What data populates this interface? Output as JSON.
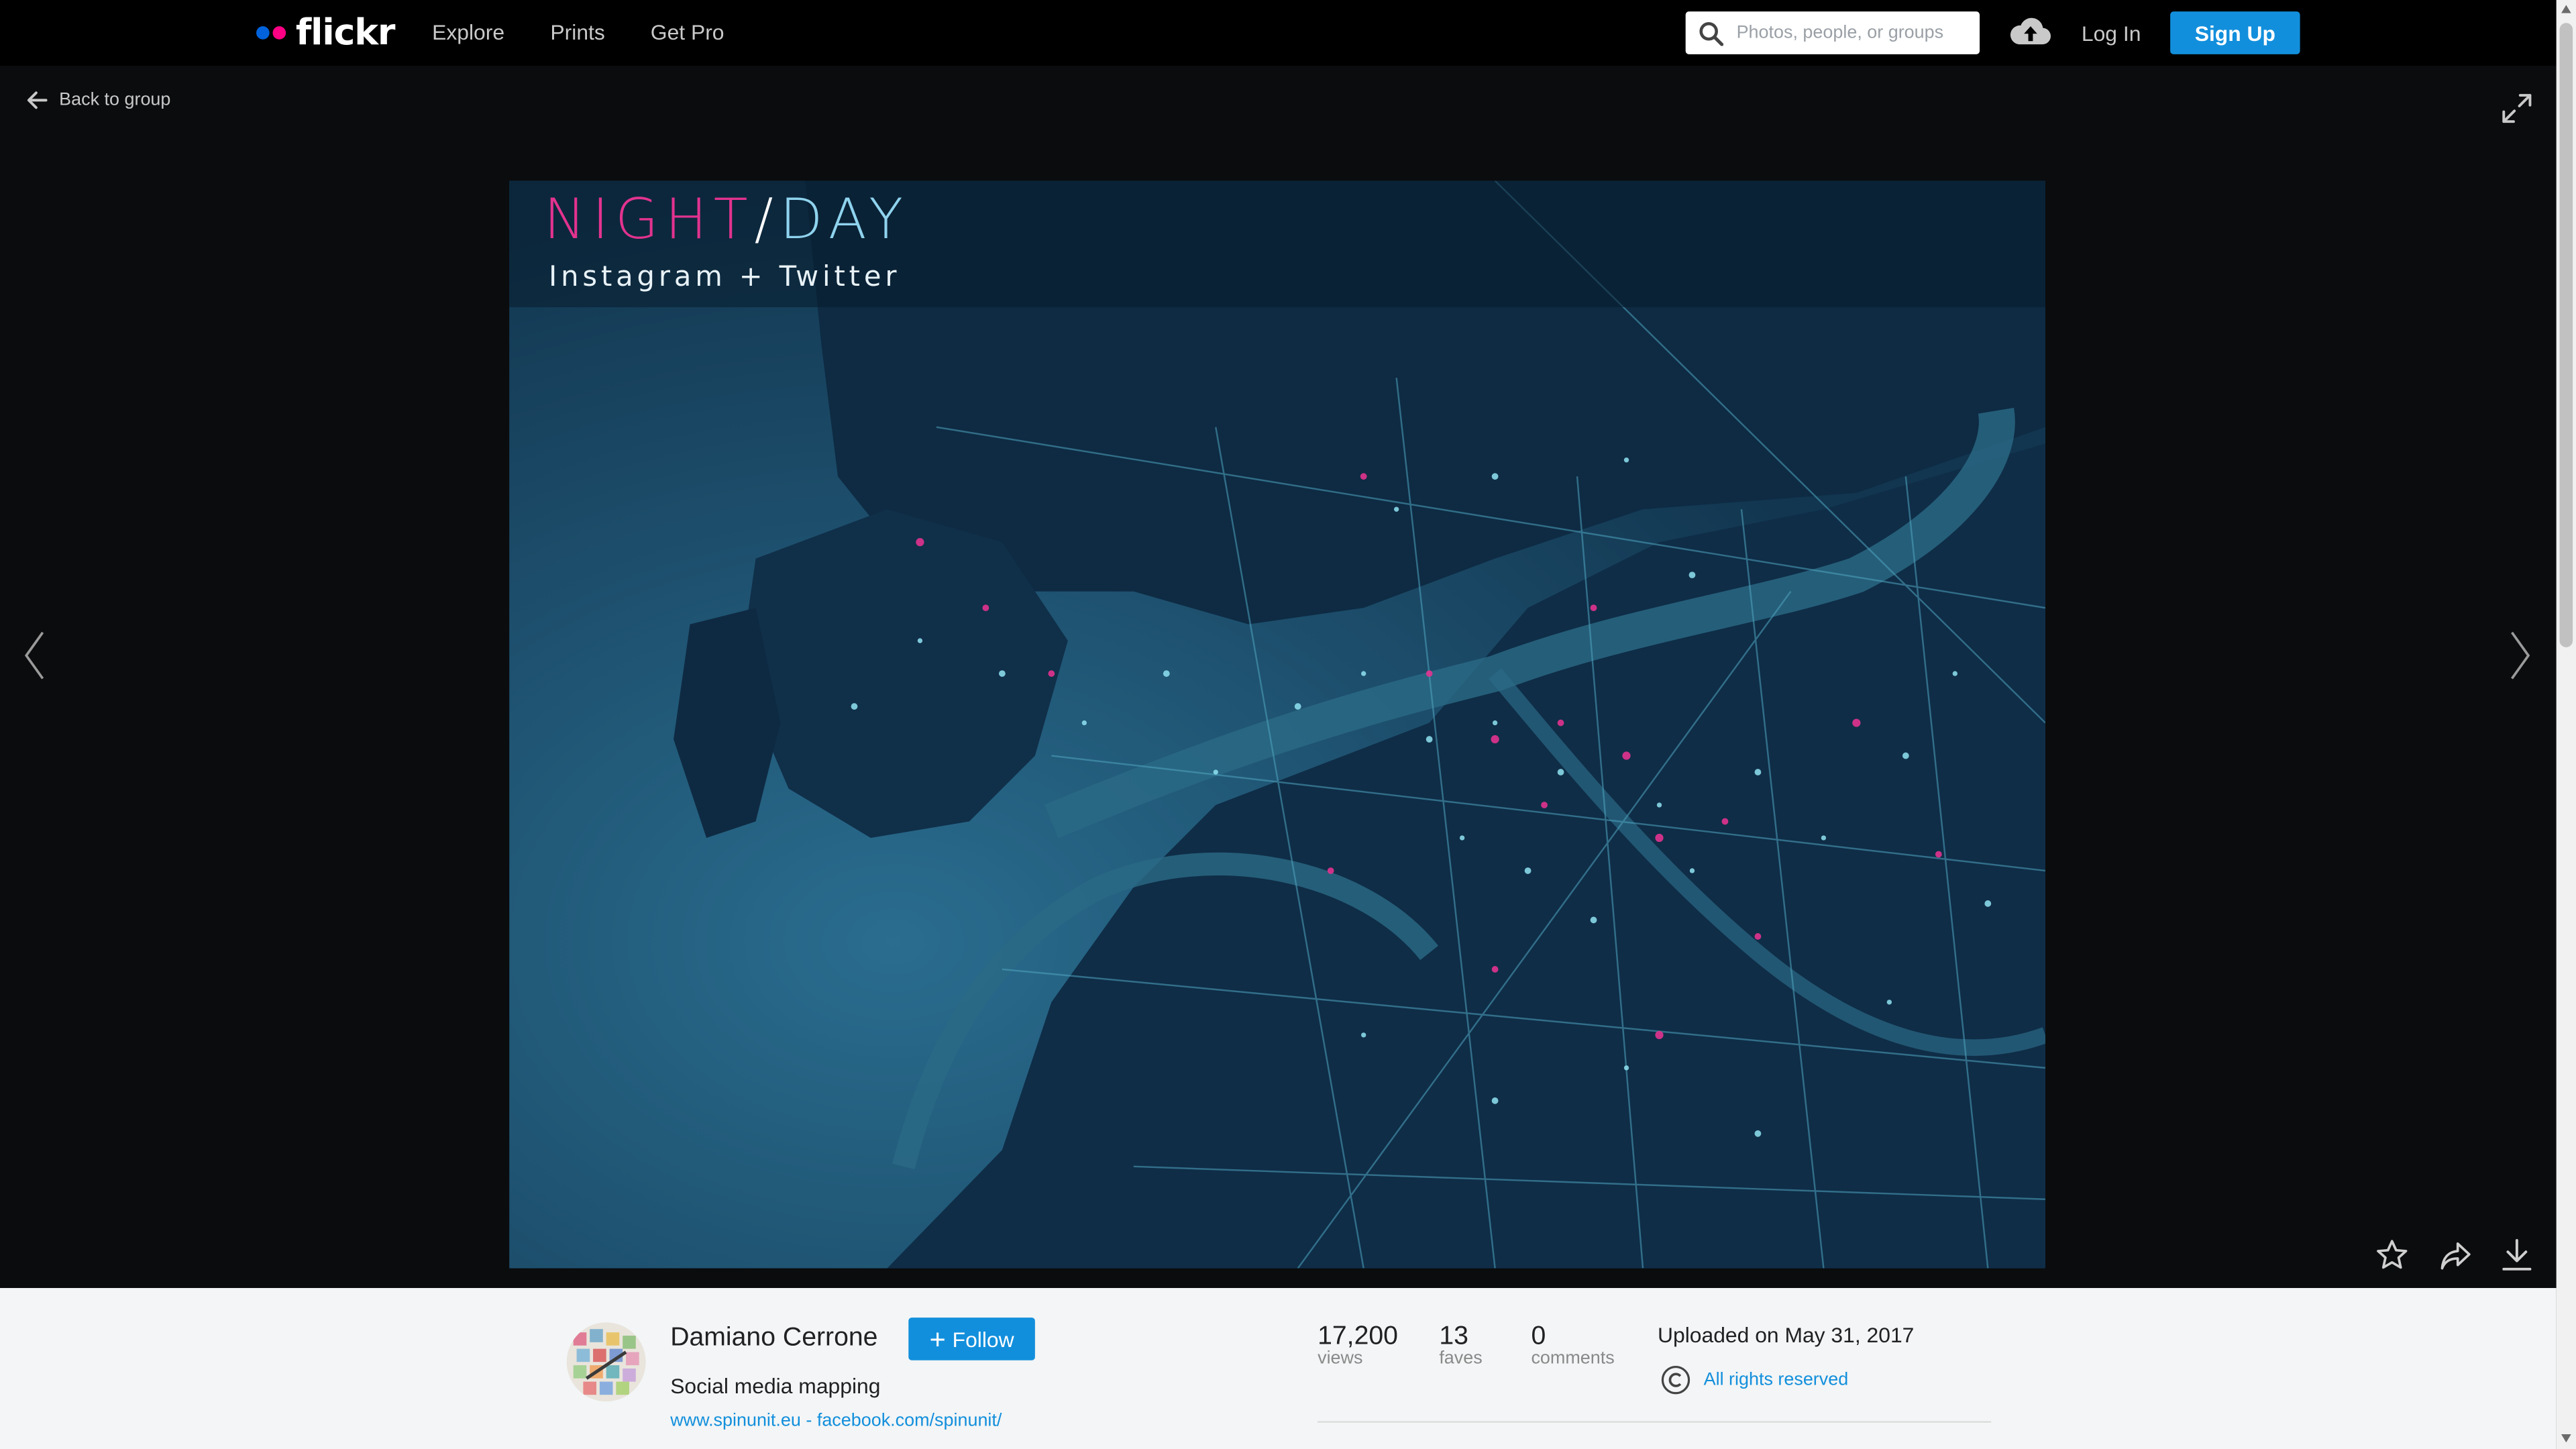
{
  "header": {
    "logo_text": "flickr",
    "logo_dot_colors": [
      "#0063dc",
      "#ff0084"
    ],
    "nav": [
      "Explore",
      "Prints",
      "Get Pro"
    ],
    "search_placeholder": "Photos, people, or groups",
    "login_label": "Log In",
    "signup_label": "Sign Up",
    "upload_icon": "cloud-upload-icon"
  },
  "viewer": {
    "back_label": "Back to group",
    "photo": {
      "title_part1": "NIGHT",
      "title_slash": "/",
      "title_part2": "DAY",
      "subtitle": "Instagram + Twitter",
      "title_colors": {
        "night": "#e2338f",
        "day": "#8fd3ee"
      }
    },
    "icons": {
      "back": "arrow-left-icon",
      "expand": "expand-icon",
      "prev": "chevron-left-icon",
      "next": "chevron-right-icon",
      "fave": "star-icon",
      "share": "share-icon",
      "download": "download-icon"
    }
  },
  "info": {
    "author_name": "Damiano Cerrone",
    "follow_label": "Follow",
    "photo_title": "Social media mapping",
    "link1": "www.spinunit.eu",
    "link_separator": " - ",
    "link2": "facebook.com/spinunit/",
    "stats": [
      {
        "value": "17,200",
        "label": "views"
      },
      {
        "value": "13",
        "label": "faves"
      },
      {
        "value": "0",
        "label": "comments"
      }
    ],
    "uploaded": "Uploaded on May 31, 2017",
    "license": "All rights reserved",
    "license_icon": "copyright-icon"
  },
  "colors": {
    "accent": "#128fdc",
    "topbar": "#000000",
    "page_bg": "#0b0c0e",
    "info_bg": "#f3f5f6"
  }
}
